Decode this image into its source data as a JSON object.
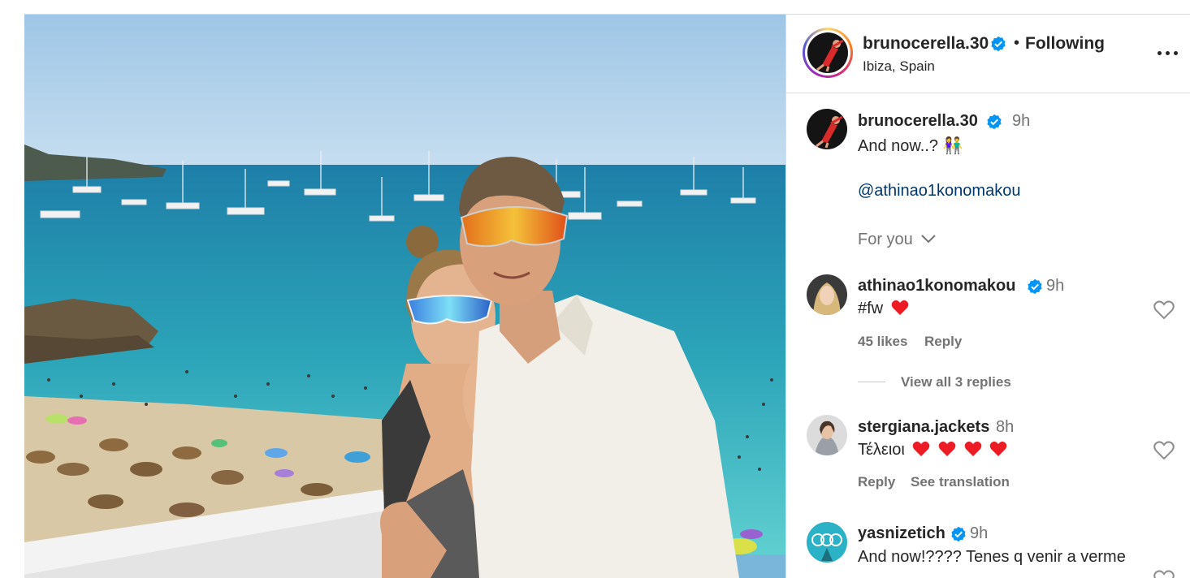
{
  "post": {
    "image_description_name": "couple-photo",
    "author": {
      "username": "brunocerella.30",
      "verified": true,
      "follow_status": "Following",
      "location": "Ibiza, Spain"
    },
    "caption": {
      "username": "brunocerella.30",
      "time": "9h",
      "text": "And now..? 👫",
      "mention": "@athinao1konomakou",
      "translation_link": "For you"
    }
  },
  "comments": [
    {
      "username": "athinao1konomakou",
      "verified": true,
      "time": "9h",
      "text": "#fw",
      "hearts": 1,
      "likes": "45 likes",
      "reply_label": "Reply",
      "view_replies": "View all 3 replies"
    },
    {
      "username": "stergiana.jackets",
      "verified": false,
      "time": "8h",
      "text": "Τέλειοι",
      "hearts": 4,
      "reply_label": "Reply",
      "translation_label": "See translation"
    },
    {
      "username": "yasnizetich",
      "verified": true,
      "time": "9h",
      "text": "And now!???? Tenes q venir a verme"
    }
  ],
  "colors": {
    "verified_blue": "#0095f6",
    "heart_red": "#ed1c24",
    "muted_text": "#737373",
    "mention_blue": "#00376b"
  },
  "icons": [
    "verified-badge-icon",
    "more-options-icon",
    "chevron-down-icon",
    "like-heart-icon",
    "red-heart-emoji-icon"
  ]
}
